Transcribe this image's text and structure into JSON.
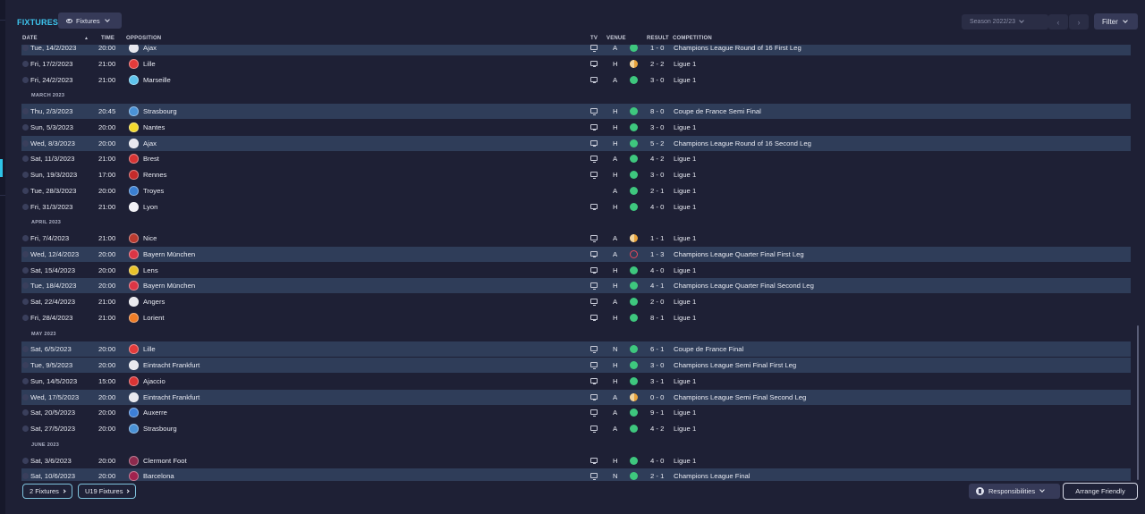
{
  "header": {
    "title": "FIXTURES",
    "view_dropdown": "Fixtures",
    "season": "Season 2022/23",
    "filter": "Filter"
  },
  "columns": {
    "date": "DATE",
    "time": "TIME",
    "opposition": "OPPOSITION",
    "tv": "TV",
    "venue": "VENUE",
    "result": "RESULT",
    "competition": "COMPETITION"
  },
  "rows": [
    {
      "type": "match",
      "date": "Tue, 14/2/2023",
      "time": "20:00",
      "opp": "Ajax",
      "badge": "#e7e7ee",
      "tv": true,
      "venue": "A",
      "res": "win",
      "score": "1 - 0",
      "comp": "Champions League Round of 16 First Leg",
      "alt": true
    },
    {
      "type": "match",
      "date": "Fri, 17/2/2023",
      "time": "21:00",
      "opp": "Lille",
      "badge": "#e23b3b",
      "tv": true,
      "venue": "H",
      "res": "draw",
      "score": "2 - 2",
      "comp": "Ligue 1",
      "alt": false
    },
    {
      "type": "match",
      "date": "Fri, 24/2/2023",
      "time": "21:00",
      "opp": "Marseille",
      "badge": "#5ec3ec",
      "tv": true,
      "venue": "A",
      "res": "win",
      "score": "3 - 0",
      "comp": "Ligue 1",
      "alt": false
    },
    {
      "type": "month",
      "label": "MARCH 2023"
    },
    {
      "type": "match",
      "date": "Thu, 2/3/2023",
      "time": "20:45",
      "opp": "Strasbourg",
      "badge": "#4a92d6",
      "tv": true,
      "venue": "H",
      "res": "win",
      "score": "8 - 0",
      "comp": "Coupe de France Semi Final",
      "alt": true
    },
    {
      "type": "match",
      "date": "Sun, 5/3/2023",
      "time": "20:00",
      "opp": "Nantes",
      "badge": "#f2d92c",
      "tv": true,
      "venue": "H",
      "res": "win",
      "score": "3 - 0",
      "comp": "Ligue 1",
      "alt": false
    },
    {
      "type": "match",
      "date": "Wed, 8/3/2023",
      "time": "20:00",
      "opp": "Ajax",
      "badge": "#e7e7ee",
      "tv": true,
      "venue": "H",
      "res": "win",
      "score": "5 - 2",
      "comp": "Champions League Round of 16 Second Leg",
      "alt": true
    },
    {
      "type": "match",
      "date": "Sat, 11/3/2023",
      "time": "21:00",
      "opp": "Brest",
      "badge": "#d63434",
      "tv": true,
      "venue": "A",
      "res": "win",
      "score": "4 - 2",
      "comp": "Ligue 1",
      "alt": false
    },
    {
      "type": "match",
      "date": "Sun, 19/3/2023",
      "time": "17:00",
      "opp": "Rennes",
      "badge": "#c42a2a",
      "tv": true,
      "venue": "H",
      "res": "win",
      "score": "3 - 0",
      "comp": "Ligue 1",
      "alt": false
    },
    {
      "type": "match",
      "date": "Tue, 28/3/2023",
      "time": "20:00",
      "opp": "Troyes",
      "badge": "#3a7fd1",
      "tv": false,
      "venue": "A",
      "res": "win",
      "score": "2 - 1",
      "comp": "Ligue 1",
      "alt": false
    },
    {
      "type": "match",
      "date": "Fri, 31/3/2023",
      "time": "21:00",
      "opp": "Lyon",
      "badge": "#f1f1f6",
      "tv": true,
      "venue": "H",
      "res": "win",
      "score": "4 - 0",
      "comp": "Ligue 1",
      "alt": false
    },
    {
      "type": "month",
      "label": "APRIL 2023"
    },
    {
      "type": "match",
      "date": "Fri, 7/4/2023",
      "time": "21:00",
      "opp": "Nice",
      "badge": "#b93a2f",
      "tv": true,
      "venue": "A",
      "res": "draw",
      "score": "1 - 1",
      "comp": "Ligue 1",
      "alt": false
    },
    {
      "type": "match",
      "date": "Wed, 12/4/2023",
      "time": "20:00",
      "opp": "Bayern München",
      "badge": "#dc3545",
      "tv": true,
      "venue": "A",
      "res": "loss",
      "score": "1 - 3",
      "comp": "Champions League Quarter Final First Leg",
      "alt": true
    },
    {
      "type": "match",
      "date": "Sat, 15/4/2023",
      "time": "20:00",
      "opp": "Lens",
      "badge": "#e8c22a",
      "tv": true,
      "venue": "H",
      "res": "win",
      "score": "4 - 0",
      "comp": "Ligue 1",
      "alt": false
    },
    {
      "type": "match",
      "date": "Tue, 18/4/2023",
      "time": "20:00",
      "opp": "Bayern München",
      "badge": "#dc3545",
      "tv": true,
      "venue": "H",
      "res": "win",
      "score": "4 - 1",
      "comp": "Champions League Quarter Final Second Leg",
      "alt": true
    },
    {
      "type": "match",
      "date": "Sat, 22/4/2023",
      "time": "21:00",
      "opp": "Angers",
      "badge": "#e9e9ee",
      "tv": true,
      "venue": "A",
      "res": "win",
      "score": "2 - 0",
      "comp": "Ligue 1",
      "alt": false
    },
    {
      "type": "match",
      "date": "Fri, 28/4/2023",
      "time": "21:00",
      "opp": "Lorient",
      "badge": "#ef7d27",
      "tv": true,
      "venue": "H",
      "res": "win",
      "score": "8 - 1",
      "comp": "Ligue 1",
      "alt": false
    },
    {
      "type": "month",
      "label": "MAY 2023"
    },
    {
      "type": "match",
      "date": "Sat, 6/5/2023",
      "time": "20:00",
      "opp": "Lille",
      "badge": "#e23b3b",
      "tv": true,
      "venue": "N",
      "res": "win",
      "score": "6 - 1",
      "comp": "Coupe de France Final",
      "alt": true
    },
    {
      "type": "match",
      "date": "Tue, 9/5/2023",
      "time": "20:00",
      "opp": "Eintracht Frankfurt",
      "badge": "#e8e8ee",
      "tv": true,
      "venue": "H",
      "res": "win",
      "score": "3 - 0",
      "comp": "Champions League Semi Final First Leg",
      "alt": true
    },
    {
      "type": "match",
      "date": "Sun, 14/5/2023",
      "time": "15:00",
      "opp": "Ajaccio",
      "badge": "#d93434",
      "tv": true,
      "venue": "H",
      "res": "win",
      "score": "3 - 1",
      "comp": "Ligue 1",
      "alt": false
    },
    {
      "type": "match",
      "date": "Wed, 17/5/2023",
      "time": "20:00",
      "opp": "Eintracht Frankfurt",
      "badge": "#e8e8ee",
      "tv": true,
      "venue": "A",
      "res": "draw",
      "score": "0 - 0",
      "comp": "Champions League Semi Final Second Leg",
      "alt": true
    },
    {
      "type": "match",
      "date": "Sat, 20/5/2023",
      "time": "20:00",
      "opp": "Auxerre",
      "badge": "#3d7fd8",
      "tv": true,
      "venue": "A",
      "res": "win",
      "score": "9 - 1",
      "comp": "Ligue 1",
      "alt": false
    },
    {
      "type": "match",
      "date": "Sat, 27/5/2023",
      "time": "20:00",
      "opp": "Strasbourg",
      "badge": "#4a92d6",
      "tv": true,
      "venue": "A",
      "res": "win",
      "score": "4 - 2",
      "comp": "Ligue 1",
      "alt": false
    },
    {
      "type": "month",
      "label": "JUNE 2023"
    },
    {
      "type": "match",
      "date": "Sat, 3/6/2023",
      "time": "20:00",
      "opp": "Clermont Foot",
      "badge": "#8d2a4d",
      "tv": true,
      "venue": "H",
      "res": "win",
      "score": "4 - 0",
      "comp": "Ligue 1",
      "alt": false
    },
    {
      "type": "match",
      "date": "Sat, 10/6/2023",
      "time": "20:00",
      "opp": "Barcelona",
      "badge": "#a0224e",
      "tv": true,
      "venue": "N",
      "res": "win",
      "score": "2 - 1",
      "comp": "Champions League Final",
      "alt": true
    }
  ],
  "footer": {
    "fixtures_link": "2 Fixtures",
    "u19_link": "U19 Fixtures",
    "responsibilities": "Responsibilities",
    "arrange_friendly": "Arrange Friendly"
  },
  "colors": {
    "accent": "#3ec6ef",
    "win": "#3ec77e",
    "draw": "#e8a33c",
    "loss": "#e4485a",
    "row_alt": "#2f3d59"
  },
  "icons": {
    "tv": "tv-icon",
    "view": "eye-icon",
    "resp": "responsibilities-icon"
  }
}
